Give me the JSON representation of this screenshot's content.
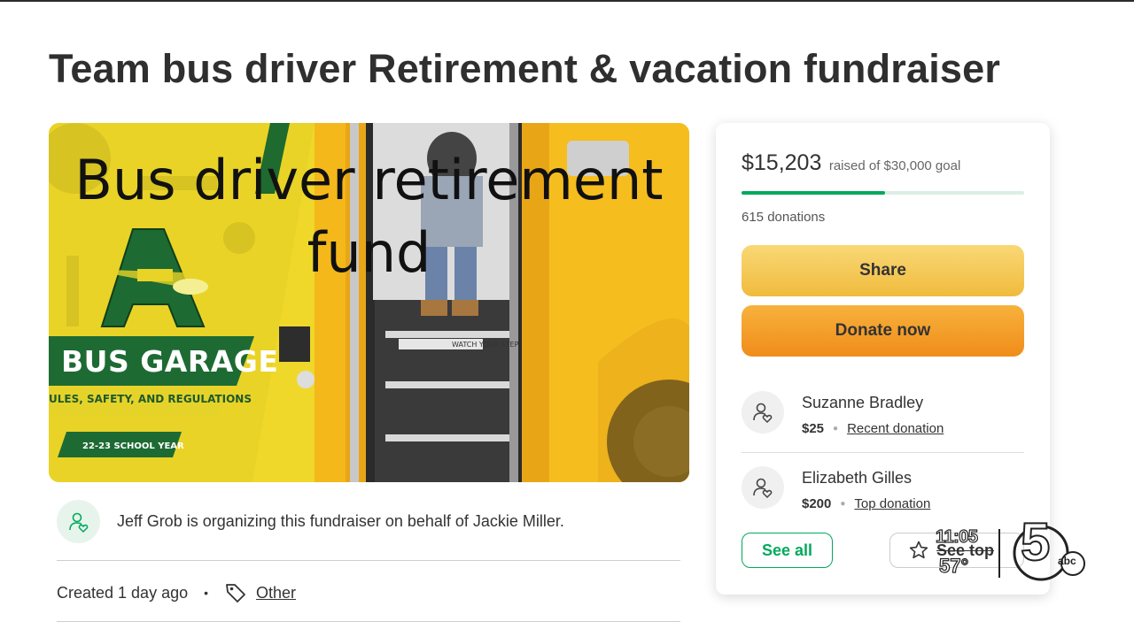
{
  "page": {
    "title": "Team bus driver Retirement & vacation fundraiser"
  },
  "hero": {
    "caption_line1": "Bus driver retirement",
    "caption_line2": "fund",
    "garage_title": "BUS GARAGE",
    "garage_subtitle": "ULES, SAFETY, AND REGULATIONS",
    "school_year": "22-23 SCHOOL YEAR",
    "step_sign": "WATCH YOUR STEP",
    "logo_letter": "A"
  },
  "organizer": {
    "text": "Jeff Grob is organizing this fundraiser on behalf of Jackie Miller.",
    "icon": "person-heart-icon"
  },
  "meta": {
    "created": "Created 1 day ago",
    "separator": "•",
    "category": "Other",
    "category_icon": "tag-icon"
  },
  "donation_card": {
    "raised_amount": "$15,203",
    "raised_goal_text": "raised of $30,000 goal",
    "progress_fraction": 0.5068,
    "donation_count": "615 donations",
    "share_label": "Share",
    "donate_label": "Donate now",
    "donors": [
      {
        "name": "Suzanne Bradley",
        "amount": "$25",
        "tag": "Recent donation"
      },
      {
        "name": "Elizabeth Gilles",
        "amount": "$200",
        "tag": "Top donation"
      }
    ],
    "see_all_label": "See all",
    "see_top_label": "See top"
  },
  "broadcast_bug": {
    "time": "11:05",
    "temperature": "57°",
    "channel_number": "5",
    "network": "abc"
  },
  "colors": {
    "accent_green": "#02a95c",
    "share_yellow": "#f3c449",
    "donate_orange": "#f29d27",
    "bus_yellow": "#f2c51f",
    "banner_green": "#1d6b33"
  }
}
